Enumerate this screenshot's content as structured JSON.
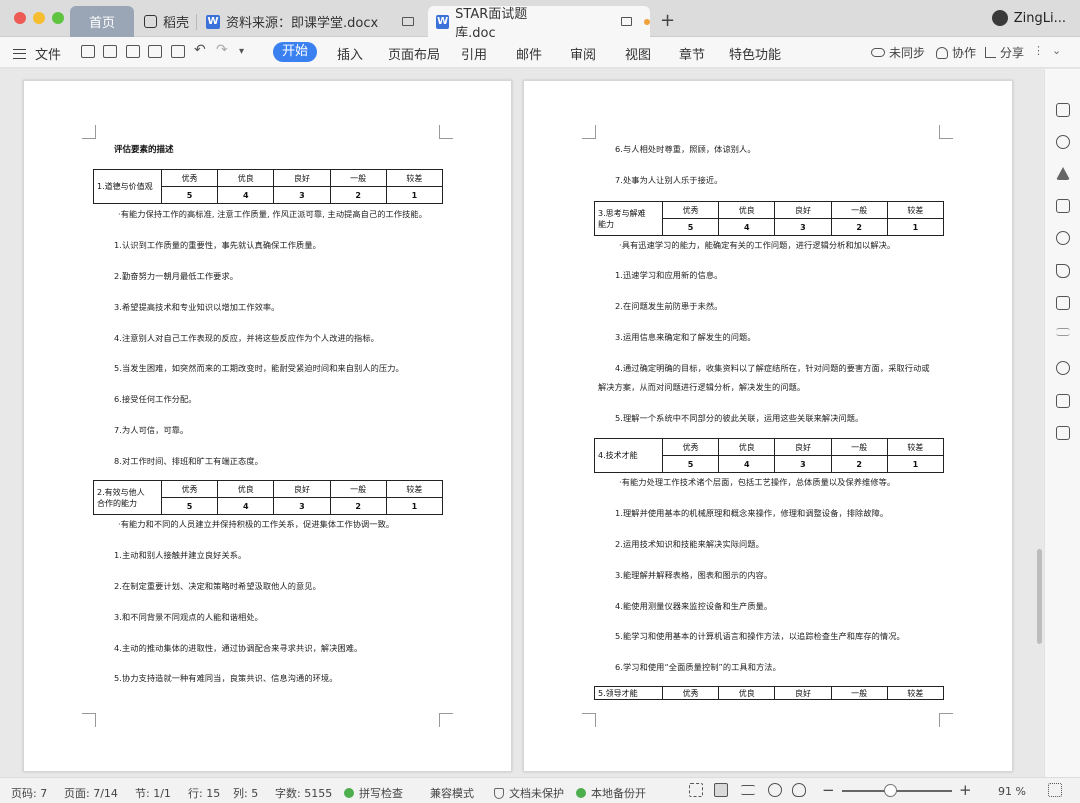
{
  "titlebar": {
    "tabs": [
      {
        "label": "首页"
      },
      {
        "label": "稻壳"
      },
      {
        "label": "资料来源：即课学堂.docx"
      },
      {
        "label": "STAR面试题库.doc"
      }
    ],
    "user": "ZingLi..."
  },
  "toolbar": {
    "file_label": "文件",
    "menus": [
      "开始",
      "插入",
      "页面布局",
      "引用",
      "邮件",
      "审阅",
      "视图",
      "章节",
      "特色功能"
    ],
    "unsynced": "未同步",
    "collab": "协作",
    "share": "分享"
  },
  "left_page": {
    "title": "评估要素的描述",
    "grade_headers": [
      "优秀",
      "优良",
      "良好",
      "一般",
      "较差"
    ],
    "grade_scores": [
      "5",
      "4",
      "3",
      "2",
      "1"
    ],
    "table1_name": "1.道德与价值观",
    "t1_intro": "·有能力保持工作的高标准, 注意工作质量, 作风正派可靠, 主动提高自己的工作技能。",
    "t1_items": [
      "1.认识到工作质量的重要性，事先就认真确保工作质量。",
      "2.勤奋努力一朝月最低工作要求。",
      "3.希望提高技术和专业知识以增加工作效率。",
      "4.注意别人对自己工作表现的反应，并将这些反应作为个人改进的指标。",
      "5.当发生困难，如突然而来的工期改变时，能耐受紧迫时间和来自别人的压力。",
      "6.接受任何工作分配。",
      "7.为人可信，可靠。",
      "8.对工作时间、排班和旷工有端正态度。"
    ],
    "table2_name_line1": "2.有效与他人",
    "table2_name_line2": "合作的能力",
    "t2_intro": "·有能力和不同的人员建立并保持积极的工作关系，促进集体工作协调一致。",
    "t2_items": [
      "1.主动和别人接触并建立良好关系。",
      "2.在制定重要计划、决定和策略时希望汲取他人的意见。",
      "3.和不同背景不同观点的人能和谐相处。",
      "4.主动的推动集体的进取性，通过协调配合来寻求共识，解决困难。",
      "5.协力支持造就一种有难同当，良策共识、信息沟通的环境。"
    ]
  },
  "right_page": {
    "top_items": [
      "6.与人相处时尊重，照顾，体谅别人。",
      "7.处事为人让别人乐于接近。"
    ],
    "table3_name_line1": "3.思考与解难",
    "table3_name_line2": "能力",
    "t3_intro": "·具有迅速学习的能力，能确定有关的工作问题，进行逻辑分析和加以解决。",
    "t3_items": [
      "1.迅速学习和应用新的信息。",
      "2.在问题发生前防患于未然。",
      "3.运用信息来确定和了解发生的问题。",
      "4.通过确定明确的目标，收集资料以了解症结所在，针对问题的要害方面，采取行动或",
      "解决方案，从而对问题进行逻辑分析，解决发生的问题。",
      "5.理解一个系统中不同部分的彼此关联，运用这些关联来解决问题。"
    ],
    "table4_name": "4.技术才能",
    "t4_intro": "·有能力处理工作技术诸个层面，包括工艺操作，总体质量以及保养维修等。",
    "t4_items": [
      "1.理解并使用基本的机械原理和概念来操作，修理和调整设备，排除故障。",
      "2.运用技术知识和技能来解决实际问题。",
      "3.能理解并解释表格，图表和图示的内容。",
      "4.能使用测量仪器来监控设备和生产质量。",
      "5.能学习和使用基本的计算机语言和操作方法，以追踪检查生产和库存的情况。",
      "6.学习和使用“全面质量控制”的工具和方法。"
    ],
    "table5_name": "5.领导才能"
  },
  "statusbar": {
    "page_code": "页码: 7",
    "page": "页面: 7/14",
    "section": "节: 1/1",
    "row": "行: 15",
    "col": "列: 5",
    "words": "字数: 5155",
    "spell": "拼写检查",
    "compat": "兼容模式",
    "protect": "文档未保护",
    "backup": "本地备份开",
    "zoom": "91 %"
  }
}
